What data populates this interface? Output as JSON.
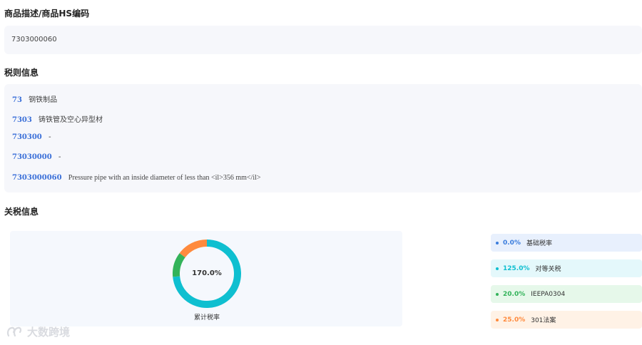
{
  "sections": {
    "hs": {
      "title": "商品描述/商品HS编码",
      "value": "7303000060"
    },
    "rules": {
      "title": "税则信息",
      "rows": [
        {
          "code": "73",
          "desc": "钢铁制品"
        },
        {
          "code": "7303",
          "desc": "铸铁管及空心异型材"
        },
        {
          "code": "730300",
          "desc": "-"
        },
        {
          "code": "73030000",
          "desc": "-"
        },
        {
          "code": "7303000060",
          "desc": "Pressure pipe with an inside diameter of less than <il>356 mm</il>"
        }
      ]
    },
    "tariff": {
      "title": "关税信息",
      "center_value": "170.0%",
      "caption": "累计税率"
    }
  },
  "chart_data": {
    "type": "pie",
    "center_label": "170.0%",
    "caption": "累计税率",
    "slices": [
      {
        "label": "基础税率",
        "value": 0.0,
        "pct_text": "0.0%",
        "color": "#3b7ddd",
        "bg": "#e8f0fd"
      },
      {
        "label": "对等关税",
        "value": 125.0,
        "pct_text": "125.0%",
        "color": "#0fbfd0",
        "bg": "#e4f8fb"
      },
      {
        "label": "IEEPA0304",
        "value": 20.0,
        "pct_text": "20.0%",
        "color": "#33b35a",
        "bg": "#e6f8ea"
      },
      {
        "label": "301法案",
        "value": 25.0,
        "pct_text": "25.0%",
        "color": "#ff8a3d",
        "bg": "#fff2e6"
      }
    ]
  },
  "watermark": {
    "text": "大数跨境"
  }
}
